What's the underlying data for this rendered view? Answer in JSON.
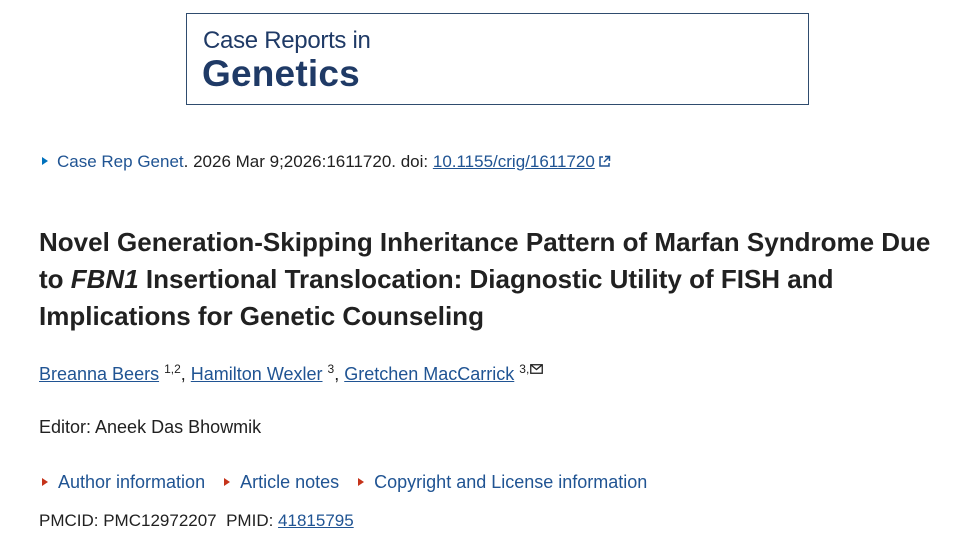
{
  "journal": {
    "line1": "Case Reports in",
    "line2": "Genetics"
  },
  "citation": {
    "journal_link": "Case Rep Genet",
    "details": ". 2026 Mar 9;2026:1611720. doi: ",
    "doi": "10.1155/crig/1611720"
  },
  "article": {
    "title_part1": "Novel Generation-Skipping Inheritance Pattern of Marfan Syndrome Due to ",
    "title_gene": "FBN1",
    "title_part2": " Insertional Translocation: Diagnostic Utility of FISH and Implications for Genetic Counseling"
  },
  "authors": [
    {
      "name": "Breanna Beers",
      "sup": "1,2"
    },
    {
      "name": "Hamilton Wexler",
      "sup": "3"
    },
    {
      "name": "Gretchen MacCarrick",
      "sup": "3,"
    }
  ],
  "editor": "Editor: Aneek Das Bhowmik",
  "info_links": [
    "Author information",
    "Article notes",
    "Copyright and License information"
  ],
  "ids": {
    "pmcid_label": "PMCID: PMC12972207",
    "pmid_label": "PMID: ",
    "pmid": "41815795"
  },
  "icons": {
    "external_link": "external-link-icon",
    "email": "envelope-icon",
    "expand_blue": "triangle-right-icon",
    "expand_red": "triangle-right-icon"
  },
  "colors": {
    "journal_blue": "#1f3a66",
    "link_blue": "#205493",
    "expand_red": "#c5331a"
  }
}
